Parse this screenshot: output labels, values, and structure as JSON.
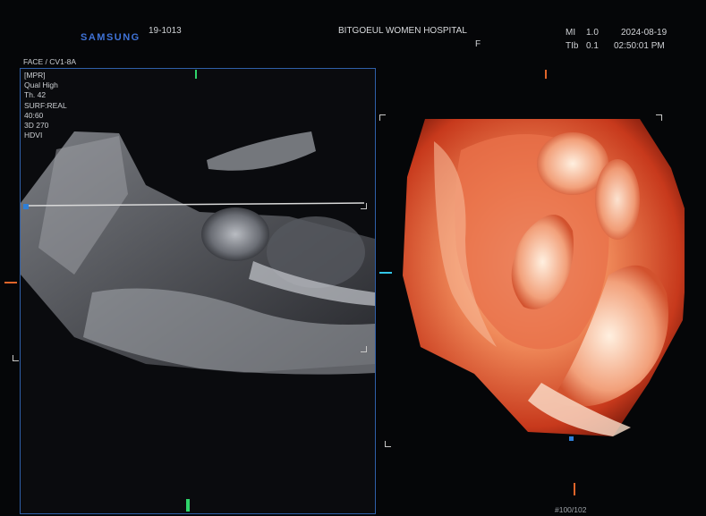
{
  "header": {
    "brand": "SAMSUNG",
    "patient_id": "19-1013",
    "hospital": "BITGOEUL WOMEN HOSPITAL",
    "sex": "F",
    "indices": [
      {
        "label": "MI",
        "value": "1.0"
      },
      {
        "label": "TIb",
        "value": "0.1"
      }
    ],
    "date": "2024-08-19",
    "time": "02:50:01 PM"
  },
  "preset": "FACE / CV1-8A",
  "left_panel": {
    "params": [
      "[MPR]",
      "Qual High",
      "Th. 42",
      "SURF:REAL",
      "40:60",
      "3D 270",
      "HDVI"
    ]
  },
  "footer": {
    "page": "#100/102"
  },
  "colors": {
    "accent_blue": "#2f5fa8",
    "render_orange": "#e4572e",
    "marker_orange": "#e0652a",
    "marker_cyan": "#33c6e8",
    "marker_green": "#2fd46a"
  }
}
